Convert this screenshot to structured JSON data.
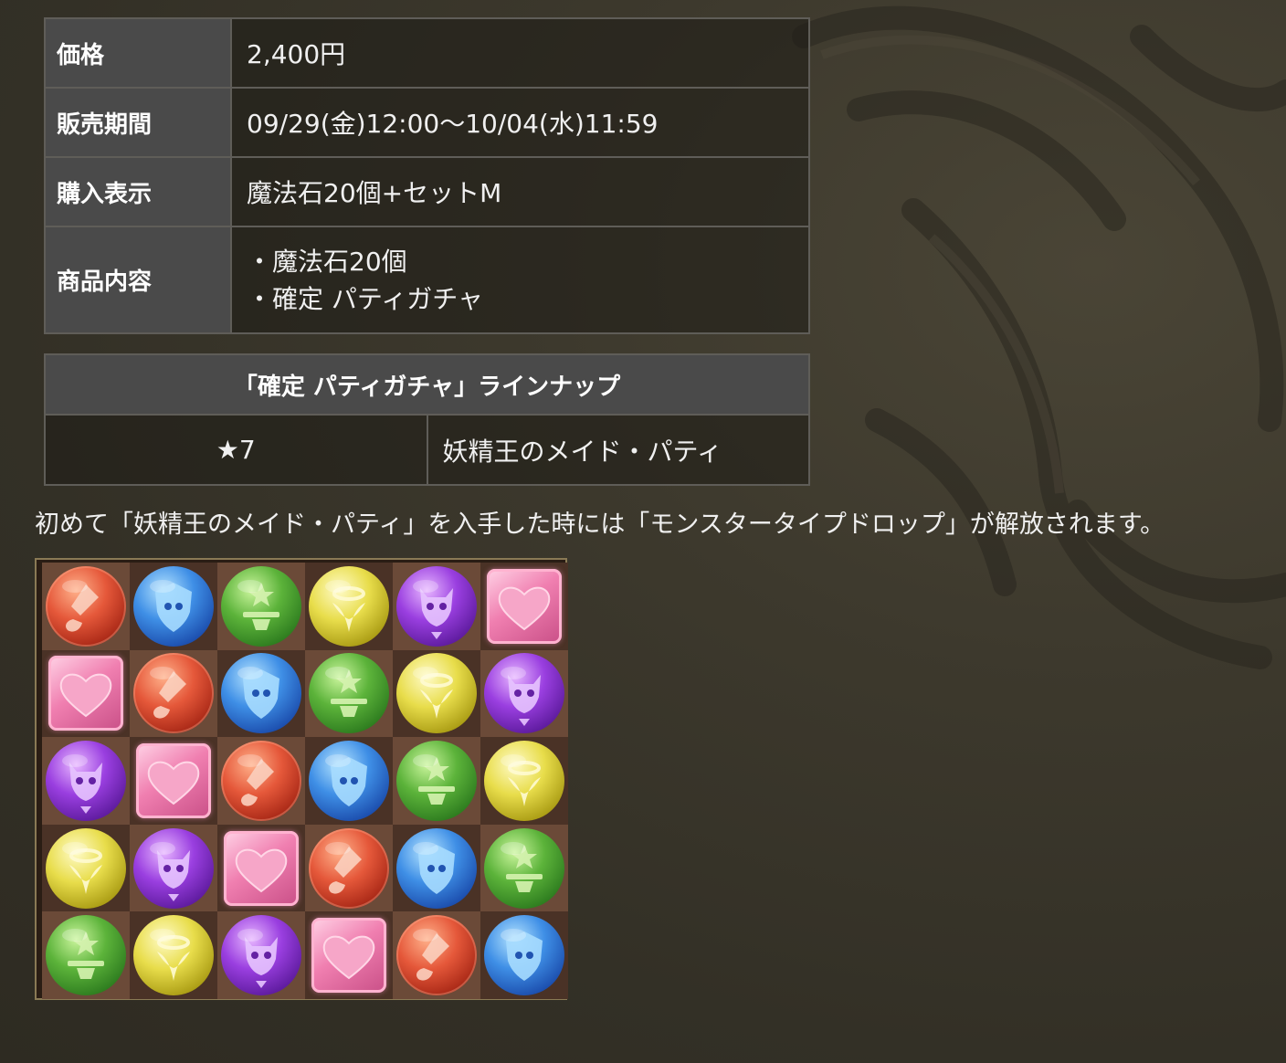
{
  "info": {
    "price_label": "価格",
    "price_value": "2,400円",
    "period_label": "販売期間",
    "period_value": "09/29(金)12:00〜10/04(水)11:59",
    "display_label": "購入表示",
    "display_value": "魔法石20個+セットM",
    "contents_label": "商品内容",
    "contents_items": [
      "・魔法石20個",
      "・確定 パティガチャ"
    ]
  },
  "lineup": {
    "header": "「確定 パティガチャ」ラインナップ",
    "rows": [
      {
        "rarity": "★7",
        "monster": "妖精王のメイド・パティ"
      }
    ]
  },
  "note": "初めて「妖精王のメイド・パティ」を入手した時には「モンスタータイプドロップ」が解放されます。",
  "board": {
    "rows": [
      [
        "fire-orb",
        "water-orb",
        "wood-orb",
        "light-orb",
        "dark-orb",
        "heart-orb"
      ],
      [
        "heart-orb",
        "fire-orb",
        "water-orb",
        "wood-orb",
        "light-orb",
        "dark-orb"
      ],
      [
        "dark-orb",
        "heart-orb",
        "fire-orb",
        "water-orb",
        "wood-orb",
        "light-orb"
      ],
      [
        "light-orb",
        "dark-orb",
        "heart-orb",
        "fire-orb",
        "water-orb",
        "wood-orb"
      ],
      [
        "wood-orb",
        "light-orb",
        "dark-orb",
        "heart-orb",
        "fire-orb",
        "water-orb"
      ]
    ]
  }
}
